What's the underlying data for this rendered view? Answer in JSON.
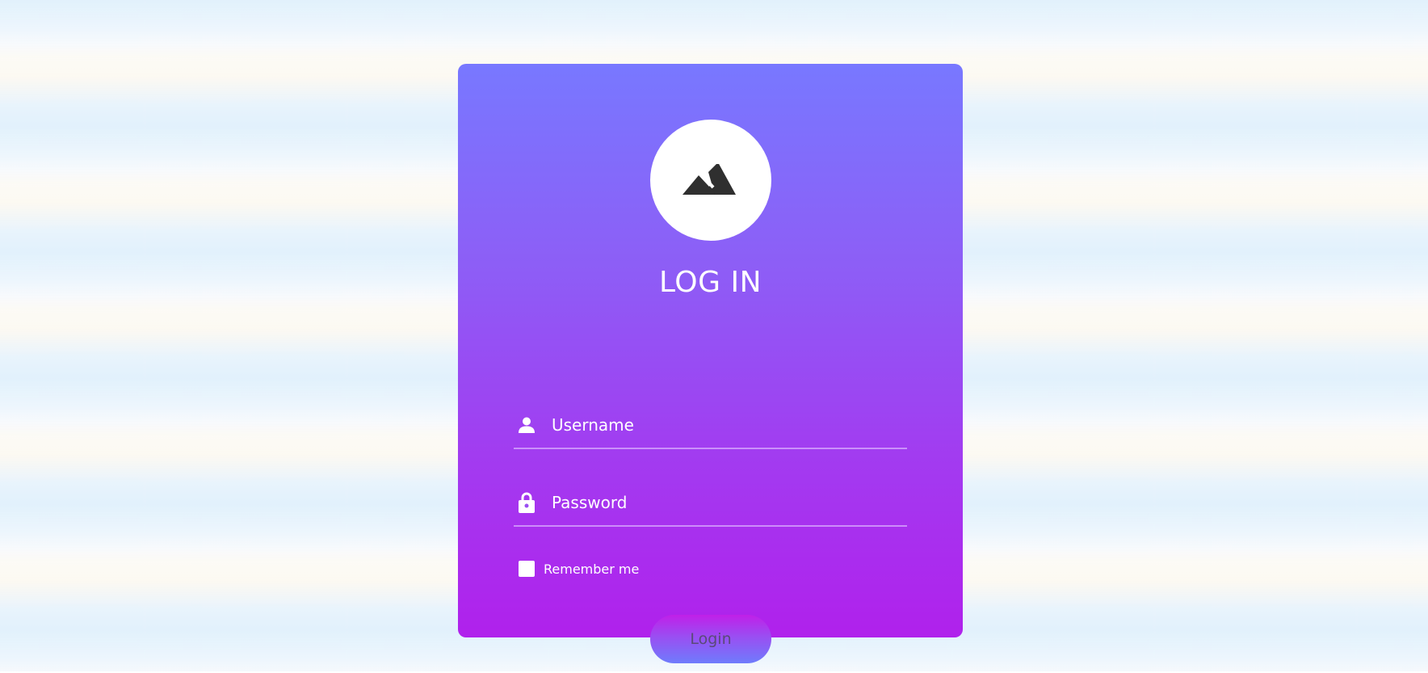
{
  "login": {
    "title": "LOG IN",
    "logo_icon": "mountain-icon",
    "username": {
      "icon": "user-icon",
      "placeholder": "Username",
      "value": ""
    },
    "password": {
      "icon": "lock-icon",
      "placeholder": "Password",
      "value": ""
    },
    "remember": {
      "label": "Remember me",
      "checked": false
    },
    "submit_label": "Login"
  },
  "colors": {
    "card_top": "#7878ff",
    "card_bottom": "#b021ec",
    "text": "#ffffff",
    "icon_dark": "#2f2f2f",
    "button_text": "#5a4a78"
  }
}
